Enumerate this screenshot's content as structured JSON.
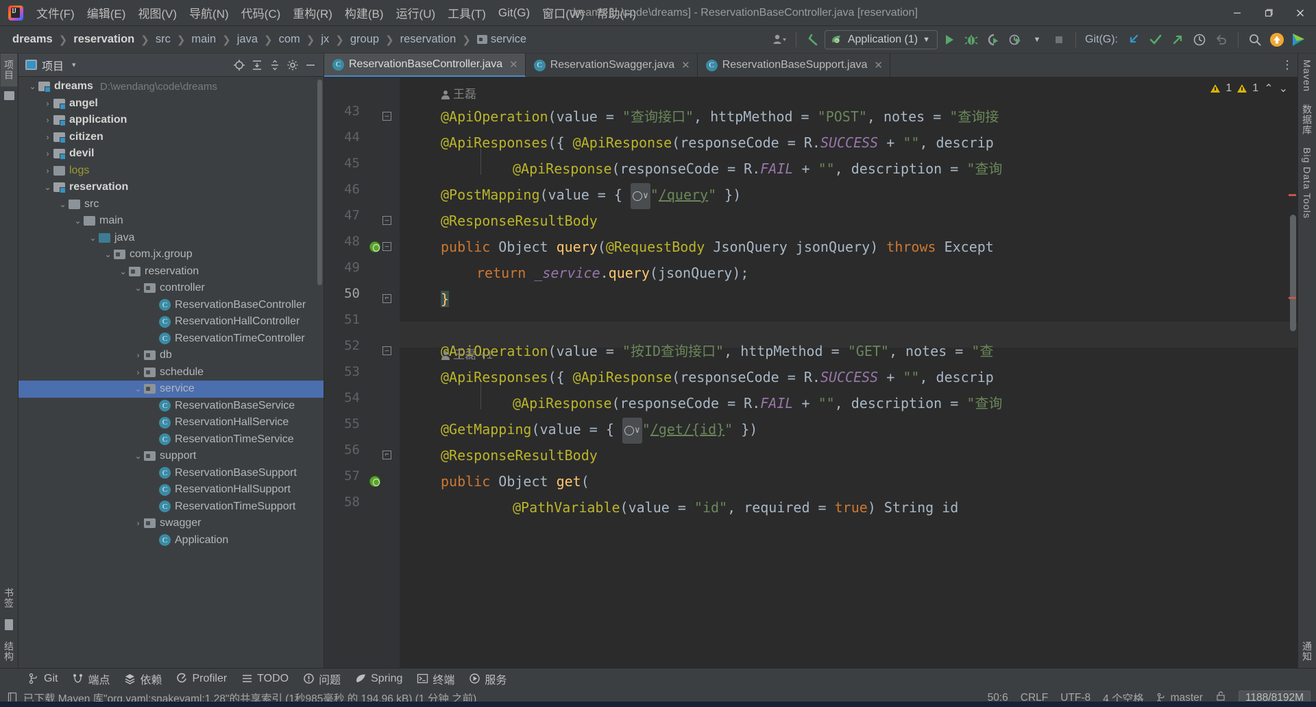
{
  "titlebar": {
    "logo_alt": "IntelliJ IDEA",
    "menus": [
      {
        "label": "文件(F)"
      },
      {
        "label": "编辑(E)"
      },
      {
        "label": "视图(V)"
      },
      {
        "label": "导航(N)"
      },
      {
        "label": "代码(C)"
      },
      {
        "label": "重构(R)"
      },
      {
        "label": "构建(B)"
      },
      {
        "label": "运行(U)"
      },
      {
        "label": "工具(T)"
      },
      {
        "label": "Git(G)"
      },
      {
        "label": "窗口(W)"
      },
      {
        "label": "帮助(H)"
      }
    ],
    "window_title": "dreams [...\\code\\dreams] - ReservationBaseController.java [reservation]",
    "minimize": "—",
    "maximize": "❐",
    "close": "✕"
  },
  "navbar": {
    "breadcrumbs": [
      {
        "label": "dreams",
        "bold": true
      },
      {
        "label": "reservation",
        "bold": true
      },
      {
        "label": "src",
        "bold": false
      },
      {
        "label": "main",
        "bold": false
      },
      {
        "label": "java",
        "bold": false
      },
      {
        "label": "com",
        "bold": false
      },
      {
        "label": "jx",
        "bold": false
      },
      {
        "label": "group",
        "bold": false
      },
      {
        "label": "reservation",
        "bold": false
      }
    ],
    "current": "service",
    "separator": "❯",
    "run_config": "Application (1)",
    "git_label": "Git(G):",
    "icons": [
      "user-icon",
      "back-arrow-icon",
      "run-icon",
      "debug-icon",
      "coverage-icon",
      "profile-icon",
      "stop-icon",
      "git-update-icon",
      "git-commit-icon",
      "git-push-icon",
      "git-history-icon",
      "git-rollback-icon",
      "search-icon",
      "update-badge-icon",
      "ide-helper-icon"
    ]
  },
  "left_strip": {
    "tabs": [
      {
        "label": "项目",
        "selected": true
      }
    ],
    "bottom_tabs": [
      {
        "label": "书签"
      },
      {
        "label": "结构"
      }
    ]
  },
  "right_strip": {
    "tabs": [
      {
        "label": "Maven"
      },
      {
        "label": "数据库"
      },
      {
        "label": "Big Data Tools"
      },
      {
        "label": "通知"
      }
    ]
  },
  "project_panel": {
    "title": "项目",
    "dropdown": "▾",
    "header_icons": [
      "locate-icon",
      "expand-all-icon",
      "collapse-all-icon",
      "settings-gear-icon",
      "hide-icon"
    ],
    "tree": [
      {
        "depth": 0,
        "chev": "⌄",
        "icon": "module",
        "name": "dreams",
        "bold": true,
        "path": "D:\\wendang\\code\\dreams"
      },
      {
        "depth": 1,
        "chev": "›",
        "icon": "module",
        "name": "angel",
        "bold": true
      },
      {
        "depth": 1,
        "chev": "›",
        "icon": "module",
        "name": "application",
        "bold": true
      },
      {
        "depth": 1,
        "chev": "›",
        "icon": "module",
        "name": "citizen",
        "bold": true
      },
      {
        "depth": 1,
        "chev": "›",
        "icon": "module",
        "name": "devil",
        "bold": true
      },
      {
        "depth": 1,
        "chev": "›",
        "icon": "folder",
        "name": "logs",
        "kind": "logs"
      },
      {
        "depth": 1,
        "chev": "⌄",
        "icon": "module",
        "name": "reservation",
        "bold": true
      },
      {
        "depth": 2,
        "chev": "⌄",
        "icon": "folder",
        "name": "src"
      },
      {
        "depth": 3,
        "chev": "⌄",
        "icon": "folder",
        "name": "main"
      },
      {
        "depth": 4,
        "chev": "⌄",
        "icon": "source-folder",
        "name": "java"
      },
      {
        "depth": 5,
        "chev": "⌄",
        "icon": "package",
        "name": "com.jx.group"
      },
      {
        "depth": 6,
        "chev": "⌄",
        "icon": "package",
        "name": "reservation"
      },
      {
        "depth": 7,
        "chev": "⌄",
        "icon": "package",
        "name": "controller"
      },
      {
        "depth": 8,
        "chev": "",
        "icon": "class",
        "name": "ReservationBaseController"
      },
      {
        "depth": 8,
        "chev": "",
        "icon": "class",
        "name": "ReservationHallController"
      },
      {
        "depth": 8,
        "chev": "",
        "icon": "class",
        "name": "ReservationTimeController"
      },
      {
        "depth": 7,
        "chev": "›",
        "icon": "package",
        "name": "db"
      },
      {
        "depth": 7,
        "chev": "›",
        "icon": "package",
        "name": "schedule"
      },
      {
        "depth": 7,
        "chev": "⌄",
        "icon": "package",
        "name": "service",
        "selected": true
      },
      {
        "depth": 8,
        "chev": "",
        "icon": "class",
        "name": "ReservationBaseService"
      },
      {
        "depth": 8,
        "chev": "",
        "icon": "class",
        "name": "ReservationHallService"
      },
      {
        "depth": 8,
        "chev": "",
        "icon": "class",
        "name": "ReservationTimeService"
      },
      {
        "depth": 7,
        "chev": "⌄",
        "icon": "package",
        "name": "support"
      },
      {
        "depth": 8,
        "chev": "",
        "icon": "class",
        "name": "ReservationBaseSupport"
      },
      {
        "depth": 8,
        "chev": "",
        "icon": "class",
        "name": "ReservationHallSupport"
      },
      {
        "depth": 8,
        "chev": "",
        "icon": "class",
        "name": "ReservationTimeSupport"
      },
      {
        "depth": 7,
        "chev": "›",
        "icon": "package",
        "name": "swagger"
      },
      {
        "depth": 8,
        "chev": "",
        "icon": "class",
        "name": "Application"
      }
    ]
  },
  "editor": {
    "tabs": [
      {
        "label": "ReservationBaseController.java",
        "active": true,
        "close": "✕"
      },
      {
        "label": "ReservationSwagger.java",
        "active": false,
        "close": "✕"
      },
      {
        "label": "ReservationBaseSupport.java",
        "active": false,
        "close": "✕"
      }
    ],
    "more_icon": "⋮",
    "inspection": {
      "warnings_1": "1",
      "warnings_2": "1",
      "up": "⌃",
      "down": "⌄"
    },
    "authors": [
      {
        "name": "王磊",
        "extra": ""
      },
      {
        "name": "王磊",
        "extra": "+1"
      }
    ],
    "line_numbers": [
      "43",
      "44",
      "45",
      "46",
      "47",
      "48",
      "49",
      "50",
      "51",
      "52",
      "53",
      "54",
      "55",
      "56",
      "57",
      "58"
    ],
    "current_line": "50",
    "code_lines": [
      "@ApiOperation(value = \"查询接口\", httpMethod = \"POST\", notes = \"查询接",
      "@ApiResponses({ @ApiResponse(responseCode = R.SUCCESS + \"\", descrip",
      "        @ApiResponse(responseCode = R.FAIL + \"\", description = \"查询",
      "@PostMapping(value = { \"/query\" })",
      "@ResponseResultBody",
      "public Object query(@RequestBody JsonQuery jsonQuery) throws Except",
      "    return _service.query(jsonQuery);",
      "}",
      "",
      "@ApiOperation(value = \"按ID查询接口\", httpMethod = \"GET\", notes = \"查",
      "@ApiResponses({ @ApiResponse(responseCode = R.SUCCESS + \"\", descrip",
      "        @ApiResponse(responseCode = R.FAIL + \"\", description = \"查询",
      "@GetMapping(value = { \"/get/{id}\" })",
      "@ResponseResultBody",
      "public Object get(",
      "    @PathVariable(value = \"id\", required = true) String id"
    ]
  },
  "bottom_tools": [
    {
      "label": "Git",
      "icon": "git-branch-icon"
    },
    {
      "label": "端点",
      "icon": "endpoints-icon"
    },
    {
      "label": "依赖",
      "icon": "dependencies-icon"
    },
    {
      "label": "Profiler",
      "icon": "profiler-icon"
    },
    {
      "label": "TODO",
      "icon": "todo-icon"
    },
    {
      "label": "问题",
      "icon": "problems-icon"
    },
    {
      "label": "Spring",
      "icon": "spring-icon"
    },
    {
      "label": "终端",
      "icon": "terminal-icon"
    },
    {
      "label": "服务",
      "icon": "services-icon"
    }
  ],
  "statusbar": {
    "message": "已下载 Maven 库\"org.yaml:snakeyaml:1.28\"的共享索引 (1秒985毫秒 的 194.96 kB) (1 分钟 之前)",
    "message_icon": "document-icon",
    "caret": "50:6",
    "line_sep": "CRLF",
    "encoding": "UTF-8",
    "indent": "4 个空格",
    "branch": "master",
    "branch_icon": "git-branch-icon",
    "lock_icon": "read-only-icon",
    "memory": "1188/8192M"
  }
}
